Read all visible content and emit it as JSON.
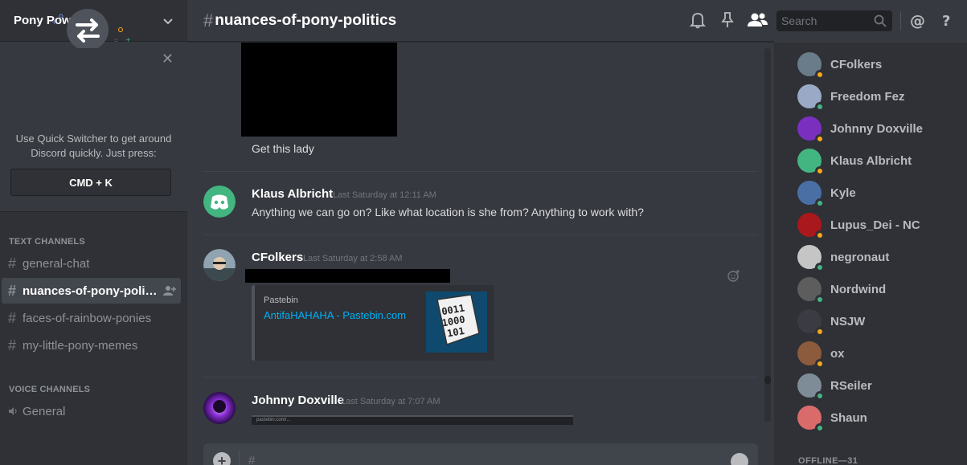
{
  "server": {
    "name": "Pony Power"
  },
  "quick_switcher": {
    "text_line1": "Use Quick Switcher to get around",
    "text_line2": "Discord quickly. Just press:",
    "shortcut": "CMD + K",
    "close": "✕"
  },
  "categories": {
    "text": "TEXT CHANNELS",
    "voice": "VOICE CHANNELS"
  },
  "channels": [
    {
      "name": "general-chat"
    },
    {
      "name": "nuances-of-pony-politics"
    },
    {
      "name": "faces-of-rainbow-ponies"
    },
    {
      "name": "my-little-pony-memes"
    }
  ],
  "voice_channels": [
    {
      "name": "General"
    }
  ],
  "header": {
    "hash": "#",
    "channel": "nuances-of-pony-politics",
    "search_placeholder": "Search"
  },
  "messages": [
    {
      "text": "Get this lady"
    },
    {
      "author": "Klaus Albricht",
      "timestamp": "Last Saturday at 12:11 AM",
      "text": "Anything we can go on? Like what location is she from? Anything to work with?"
    },
    {
      "author": "CFolkers",
      "timestamp": "Last Saturday at 2:58 AM",
      "embed": {
        "provider": "Pastebin",
        "title": "AntifaHAHAHA - Pastebin.com",
        "thumb_text": "0011\n1000\n101"
      }
    },
    {
      "author": "Johnny Doxville",
      "timestamp": "Last Saturday at 7:07 AM",
      "link": "pastebin.com/..."
    }
  ],
  "composer": {
    "placeholder": "#"
  },
  "members": [
    {
      "name": "CFolkers",
      "status": "idle",
      "avatar_color": "#6a7b8a"
    },
    {
      "name": "Freedom Fez",
      "status": "online",
      "avatar_color": "#9aa9c6"
    },
    {
      "name": "Johnny Doxville",
      "status": "idle",
      "avatar_color": "#7b2fbf"
    },
    {
      "name": "Klaus Albricht",
      "status": "idle",
      "avatar_color": "#43b581"
    },
    {
      "name": "Kyle",
      "status": "online",
      "avatar_color": "#4a6fa5"
    },
    {
      "name": "Lupus_Dei - NC",
      "status": "idle",
      "avatar_color": "#a8181c"
    },
    {
      "name": "negronaut",
      "status": "online",
      "avatar_color": "#c5c5c5"
    },
    {
      "name": "Nordwind",
      "status": "online",
      "avatar_color": "#5d5d5d"
    },
    {
      "name": "NSJW",
      "status": "idle",
      "avatar_color": "#3b3b44"
    },
    {
      "name": "ox",
      "status": "idle",
      "avatar_color": "#8c5a3c"
    },
    {
      "name": "RSeiler",
      "status": "online",
      "avatar_color": "#7d8c96"
    },
    {
      "name": "Shaun",
      "status": "online",
      "avatar_color": "#d96b6b"
    }
  ],
  "offline_label": "OFFLINE—31",
  "colors": {
    "online": "#43b581",
    "idle": "#faa61a",
    "link": "#00b0f4",
    "brand": "#7289da"
  }
}
